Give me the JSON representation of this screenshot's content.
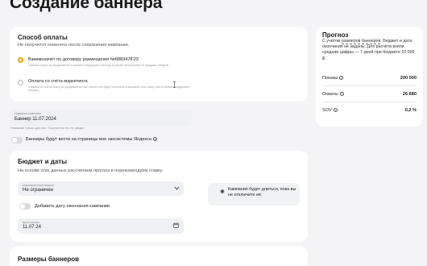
{
  "page_title": "Создание баннера",
  "payment": {
    "title": "Способ оплаты",
    "subtitle": "Не получится поменять после сохранения кампании.",
    "option1": {
      "label": "Взаимозачёт по договору размещения №6883478'23",
      "note": "Спишем плату за продвижение в начале следующего месяца из денег, полученных от продажи товаров."
    },
    "option2": {
      "label": "Оплата со счёта маркетинга",
      "note": "Спишем со счёта плату за продвижение как только она будет оплачена в договоре или сразу, или в начале следующего месяца."
    }
  },
  "campaign_name": {
    "label": "Название кампании",
    "value": "Баннер 11.07.2024",
    "hint": "Название только для вас. Покупатели его не увидят."
  },
  "ecosystem_toggle": {
    "label": "Баннеры будут вести на страницы вне экосистемы Яндекса"
  },
  "budget": {
    "title": "Бюджет и даты",
    "subtitle": "На основе этих данных рассчитаем прогноз и порекомендуем ставку.",
    "max_budget_label": "Максимальный бюджет",
    "max_budget_value": "Не ограничен",
    "end_date_toggle": "Добавить дату окончания кампании",
    "start_date_label": "Дата начала",
    "start_date_value": "11.07.24",
    "tip": "Кампания будет длиться, пока вы не отключите её."
  },
  "sizes": {
    "title": "Размеры баннеров"
  },
  "forecast": {
    "title": "Прогноз",
    "text_1": "С учетом ",
    "text_link": "размеров баннеров",
    "text_2": ". Бюджет и дата окончания не заданы. Для расчёта взяли средние цифры — 7 дней при бюджете 10 000 ₽.",
    "rows": [
      {
        "key": "Показы",
        "value": "200 000"
      },
      {
        "key": "Охваты",
        "value": "26 680"
      },
      {
        "key": "SOV",
        "value": "0,2 %"
      }
    ]
  },
  "icons": {
    "info": "info-icon",
    "chevron": "chevron-down-icon",
    "calendar": "calendar-icon",
    "bulb": "lightbulb-icon",
    "cursor": "text-cursor-icon"
  },
  "colors": {
    "accent": "#f0a400",
    "background": "#f4f4f6",
    "card": "#ffffff",
    "field": "#eef0f3"
  }
}
